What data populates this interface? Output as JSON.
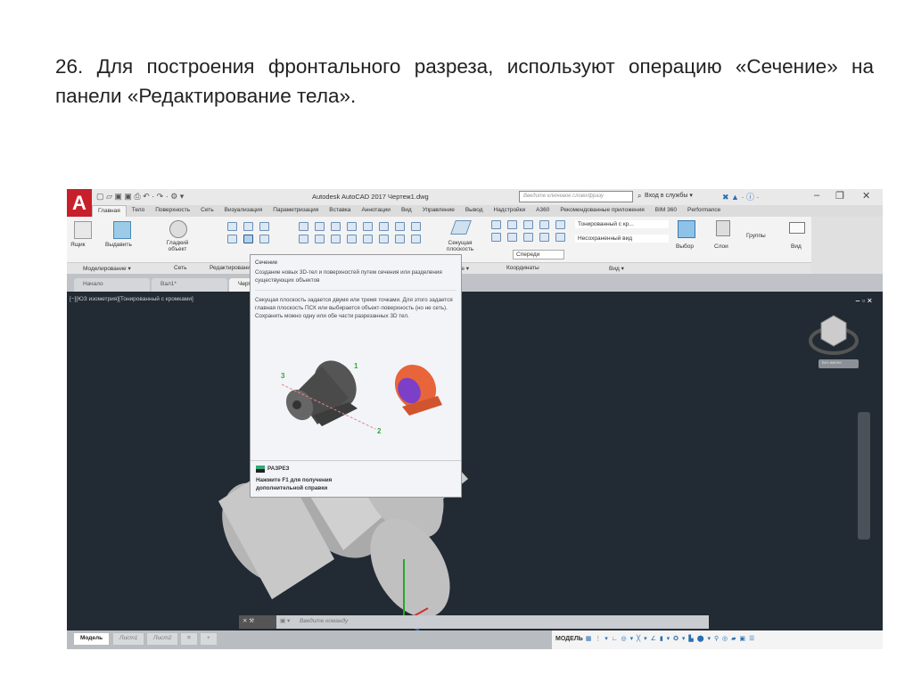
{
  "slide": {
    "title": "26. Для построения фронтального разреза, используют операцию «Сечение» на панели «Редактирование тела»."
  },
  "app": {
    "title": "Autodesk AutoCAD 2017   Чертеж1.dwg",
    "logo": "A",
    "search_placeholder": "Введите ключевое слово/фразу",
    "signin": "Вход в службы ▾"
  },
  "tabs": [
    "Главная",
    "Тело",
    "Поверхность",
    "Сеть",
    "Визуализация",
    "Параметризация",
    "Вставка",
    "Аннотации",
    "Вид",
    "Управление",
    "Вывод",
    "Надстройки",
    "A360",
    "Рекомендованные приложения",
    "BIM 360",
    "Performance"
  ],
  "ribbon": {
    "box": "Ящик",
    "extrude": "Выдавить",
    "smooth": "Гладкий объект",
    "slice": "Секущая плоскость",
    "visual_style": "Тонированный с кр...",
    "saved_view": "Несохраненный вид",
    "front": "Спереди",
    "select": "Выбор",
    "layers": "Слои",
    "groups": "Группы",
    "view": "Вид",
    "panels": [
      "Моделирование ▾",
      "Сеть",
      "Редактирование тела",
      "Сечение ▾",
      "Координаты",
      "Вид ▾"
    ]
  },
  "doc_tabs": [
    "Начало",
    "Вал1*",
    "Чертеж1*"
  ],
  "viewport": {
    "label": "[−][ЮЗ изометрия][Тонированный с кромками]",
    "controls": "– ▫ ×",
    "viewcube_label": "Без имени"
  },
  "tooltip": {
    "title": "Сечение",
    "description": "Создание новых 3D-тел и поверхностей путем сечения или разделения существующих объектов",
    "details": "Секущая плоскость задается двумя или тремя точками. Для этого задается главная плоскость ПСК или выбирается объект-поверхность (но не сеть). Сохранить можно одну или обе части разрезанных 3D тел.",
    "points": [
      "1",
      "2",
      "3"
    ],
    "command": "РАЗРЕЗ",
    "help": "Нажмите F1 для получения дополнительной справки"
  },
  "command_line": {
    "placeholder": "Введите команду"
  },
  "layout_tabs": [
    "Модель",
    "Лист1",
    "Лист2"
  ],
  "status": {
    "model": "МОДЕЛЬ"
  }
}
